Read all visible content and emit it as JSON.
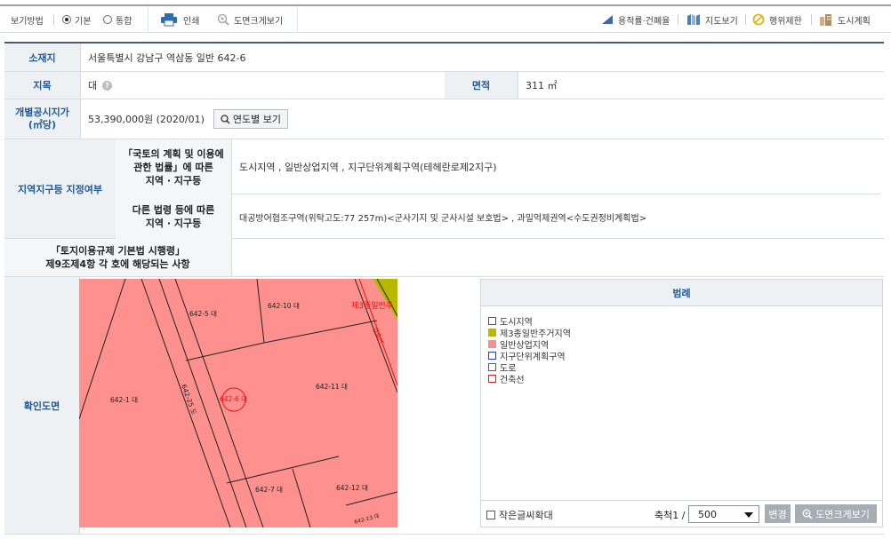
{
  "toolbar": {
    "view_mode_label": "보기방법",
    "view_basic_label": "기본",
    "view_integrated_label": "통합",
    "print_label": "인쇄",
    "enlarge_map_label": "도면크게보기",
    "floor_area_label": "용적률·건폐율",
    "map_view_label": "지도보기",
    "restriction_label": "행위제한",
    "urban_plan_label": "도시계획"
  },
  "table": {
    "location_header": "소재지",
    "location_value": "서울특별시 강남구 역삼동 일반 642-6",
    "land_category_header": "지목",
    "land_category_value": "대",
    "area_header": "면적",
    "area_value": "311 ㎡",
    "land_price_header": "개별공시지가\n(㎡당)",
    "land_price_value": "53,390,000원 (2020/01)",
    "yearly_button_label": "연도별 보기",
    "zoning_header": "지역지구등 지정여부",
    "national_law_header": "「국토의 계획 및 이용에\n관한 법률」에 따른\n지역 · 지구등",
    "national_law_value": "도시지역 , 일반상업지역 , 지구단위계획구역(테헤란로제2지구)",
    "other_law_header": "다른 법령 등에 따른\n지역 · 지구등",
    "other_law_value": "대공방어협조구역(위탁고도:77 257m)<군사기지 및 군사시설 보호법> , 과밀억제권역<수도권정비계획법>",
    "enforcement_header": "「토지이용규제 기본법 시행령」\n제9조제4항 각 호에 해당되는 사항",
    "map_header": "확인도면"
  },
  "map": {
    "parcels": [
      "642-5 대",
      "642-10 대",
      "642-1 대",
      "642-25 도",
      "642-11 대",
      "642-7 대",
      "642-12 대",
      "642-6 대",
      "642-13 대"
    ],
    "zone_label": "제3종일반주",
    "building_line_label": "건축선",
    "colors": {
      "commercial": "#fe908d",
      "residential": "#b8b800",
      "boundary": "#222222",
      "road_line": "#ff0000"
    }
  },
  "legend": {
    "title": "범례",
    "items": [
      {
        "label": "도시지역",
        "color": "#ffffff",
        "style": "outline",
        "border": "#555555"
      },
      {
        "label": "제3종일반주거지역",
        "color": "#b8b800",
        "style": "fill",
        "border": "#b8b800"
      },
      {
        "label": "일반상업지역",
        "color": "#ff8c8c",
        "style": "fill",
        "border": "#ff8c8c"
      },
      {
        "label": "지구단위계획구역",
        "color": "#ffffff",
        "style": "outline",
        "border": "#1f3ed8"
      },
      {
        "label": "도로",
        "color": "#ffffff",
        "style": "outline",
        "border": "#e62020"
      },
      {
        "label": "건축선",
        "color": "#ffffff",
        "style": "outline",
        "border": "#e62020"
      }
    ],
    "small_text_label": "작은글씨확대",
    "scale_label": "축척1 /",
    "scale_value": "500",
    "change_button_label": "변경",
    "enlarge_button_label": "도면크게보기"
  }
}
